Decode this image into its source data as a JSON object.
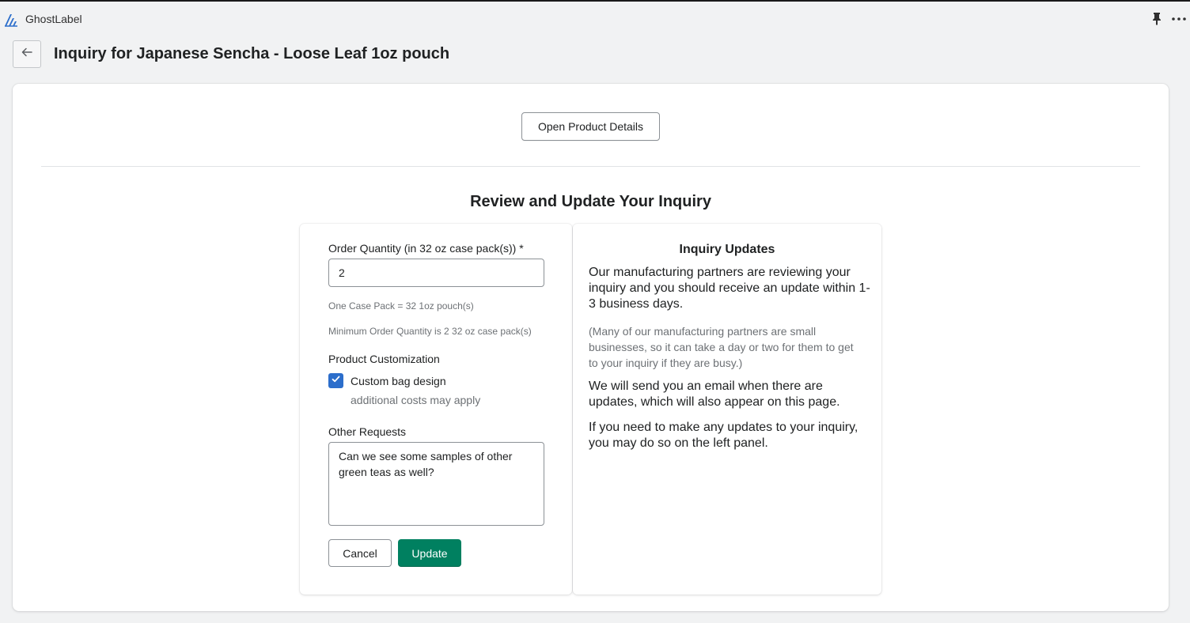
{
  "app": {
    "name": "GhostLabel"
  },
  "header": {
    "page_title": "Inquiry for Japanese Sencha - Loose Leaf 1oz pouch"
  },
  "main": {
    "open_details_label": "Open Product Details",
    "section_title": "Review and Update Your Inquiry"
  },
  "form": {
    "quantity_label": "Order Quantity (in 32 oz case pack(s)) *",
    "quantity_value": "2",
    "case_pack_help": "One Case Pack = 32 1oz pouch(s)",
    "min_order_help": "Minimum Order Quantity is 2 32 oz case pack(s)",
    "customization_label": "Product Customization",
    "custom_bag_label": "Custom bag design",
    "custom_bag_checked": true,
    "custom_bag_help": "additional costs may apply",
    "other_requests_label": "Other Requests",
    "other_requests_value": "Can we see some samples of other green teas as well?",
    "cancel_label": "Cancel",
    "update_label": "Update"
  },
  "updates": {
    "title": "Inquiry Updates",
    "paragraph1": "Our manufacturing partners are reviewing your inquiry and you should receive an update within 1-3 business days.",
    "note": "(Many of our manufacturing partners are small businesses, so it can take a day or two for them to get to your inquiry if they are busy.)",
    "paragraph2": "We will send you an email when there are updates, which will also appear on this page.",
    "paragraph3": "If you need to make any updates to your inquiry, you may do so on the left panel."
  },
  "icons": {
    "logo": "ghostlabel-logo-icon",
    "pin": "pin-icon",
    "more": "more-horizontal-icon",
    "back": "arrow-left-icon",
    "check": "checkmark-icon"
  },
  "colors": {
    "primary_button": "#008060",
    "checkbox": "#2c6ecb",
    "logo": "#2c6ecb",
    "page_background": "#f1f2f3"
  }
}
